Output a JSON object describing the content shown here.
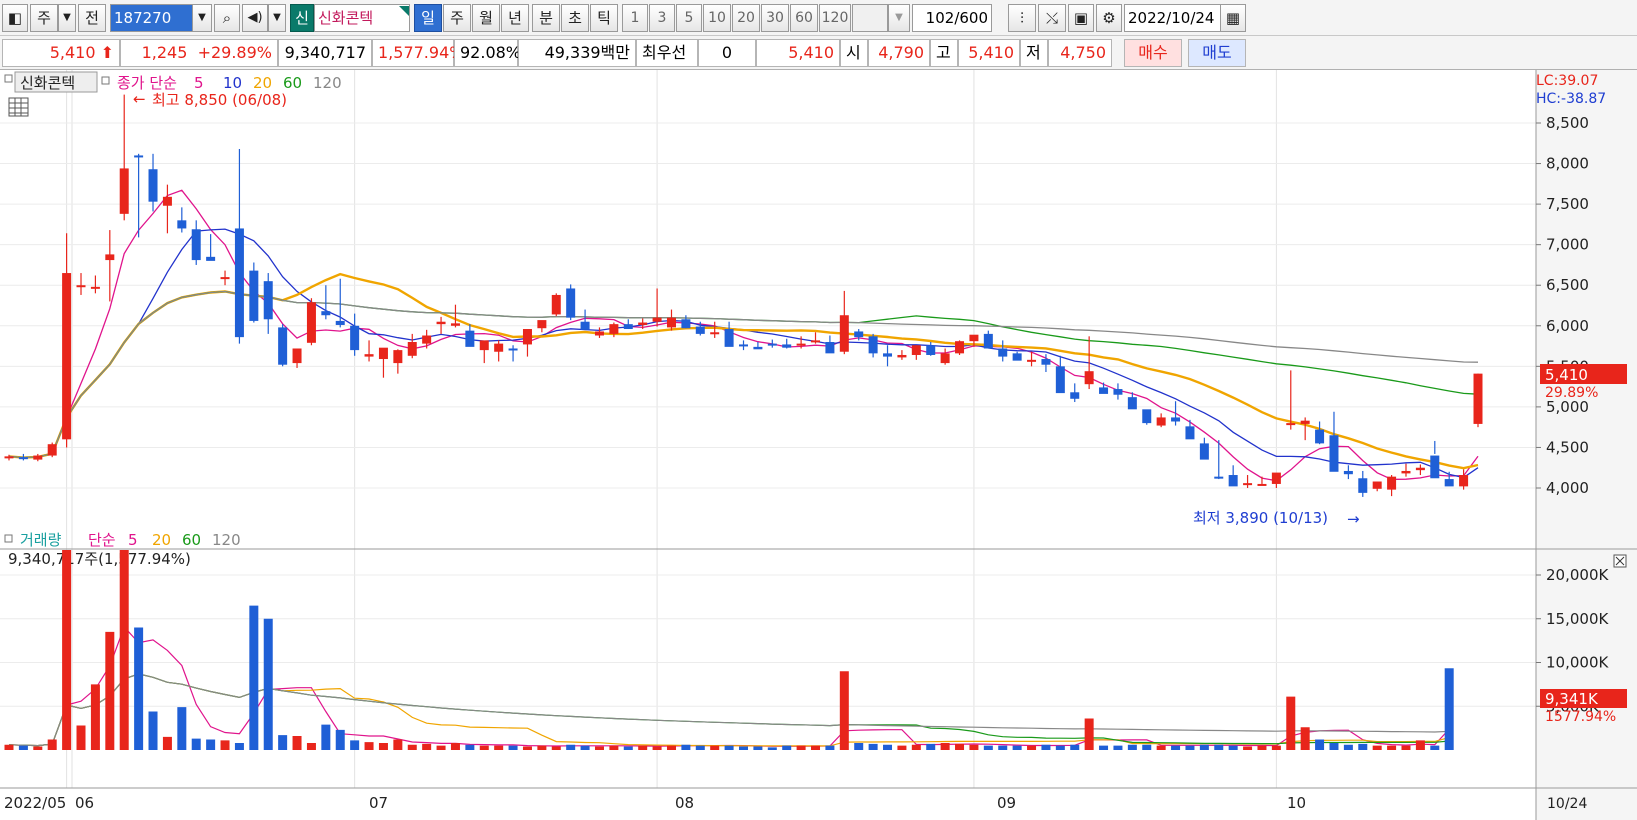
{
  "toolbar": {
    "market_tab": "주",
    "prev_button": "전",
    "code": "187270",
    "credit_badge": "신",
    "stock_name": "신화콘텍",
    "periods": [
      "일",
      "주",
      "월",
      "년",
      "분",
      "초",
      "틱"
    ],
    "active_period": "일",
    "intervals": [
      "1",
      "3",
      "5",
      "10",
      "20",
      "30",
      "60",
      "120"
    ],
    "count": "102",
    "count_total": "/600",
    "date": "2022/10/24"
  },
  "quote": {
    "price": "5,410",
    "change": "1,245",
    "change_pct": "+29.89%",
    "volume": "9,340,717",
    "volume_pct": "1,577.94%",
    "turnover_pct": "92.08%",
    "amount": "49,339백만",
    "best_label": "최우선",
    "best_value": "0",
    "best_price": "5,410",
    "open_label": "시",
    "open": "4,790",
    "high_label": "고",
    "high": "5,410",
    "low_label": "저",
    "low": "4,750",
    "buy_button": "매수",
    "sell_button": "매도"
  },
  "price_panel": {
    "title": "신화콘텍",
    "ma_label": "종가 단순",
    "ma_periods": [
      "5",
      "10",
      "20",
      "60",
      "120"
    ],
    "ma_colors": [
      "#e0148c",
      "#2233cc",
      "#f0a500",
      "#1a9a1a",
      "#888888"
    ],
    "lc": "LC:39.07",
    "hc": "HC:-38.87",
    "high_marker": "최고 8,850 (06/08)",
    "low_marker": "최저 3,890 (10/13)",
    "last_price_tag": "5,410",
    "last_pct_tag": "29.89%",
    "y_ticks": [
      "8,500",
      "8,000",
      "7,500",
      "7,000",
      "6,500",
      "6,000",
      "5,500",
      "5,000",
      "4,500",
      "4,000"
    ]
  },
  "volume_panel": {
    "title": "거래량",
    "ma_label": "단순",
    "ma_periods": [
      "5",
      "20",
      "60",
      "120"
    ],
    "value_text": "9,340,717주(1,577.94%)",
    "last_tag": "9,341K",
    "last_pct_tag": "1577.94%",
    "y_ticks": [
      "20,000K",
      "15,000K",
      "10,000K",
      "5,000K"
    ]
  },
  "x_axis": {
    "labels": [
      "2022/05",
      "06",
      "07",
      "08",
      "09",
      "10"
    ],
    "right_label": "10/24"
  },
  "colors": {
    "up": "#e8251b",
    "down": "#1f5fd6",
    "accent": "#2f6fd1"
  },
  "chart_data": {
    "type": "candlestick",
    "price_axis": [
      3500,
      8900
    ],
    "volume_axis_k": [
      0,
      25000
    ],
    "candles": [
      [
        4370,
        4410,
        4340,
        4390
      ],
      [
        4380,
        4420,
        4340,
        4360
      ],
      [
        4350,
        4420,
        4330,
        4400
      ],
      [
        4400,
        4560,
        4380,
        4540
      ],
      [
        4600,
        7140,
        4500,
        6650
      ],
      [
        6480,
        6650,
        6380,
        6500
      ],
      [
        6460,
        6620,
        6400,
        6480
      ],
      [
        6810,
        7180,
        6300,
        6880
      ],
      [
        7380,
        8850,
        7300,
        7940
      ],
      [
        8100,
        8120,
        7090,
        8090
      ],
      [
        7930,
        8120,
        7410,
        7530
      ],
      [
        7480,
        7740,
        7140,
        7590
      ],
      [
        7300,
        7460,
        7150,
        7200
      ],
      [
        7190,
        7300,
        6750,
        6810
      ],
      [
        6850,
        7130,
        6830,
        6800
      ],
      [
        6580,
        6680,
        6500,
        6600
      ],
      [
        7200,
        8180,
        5780,
        5860
      ],
      [
        6680,
        6780,
        6040,
        6060
      ],
      [
        6550,
        6650,
        5900,
        6080
      ],
      [
        5980,
        6020,
        5500,
        5520
      ],
      [
        5540,
        5720,
        5480,
        5720
      ],
      [
        5790,
        6340,
        5760,
        6290
      ],
      [
        6180,
        6500,
        6080,
        6130
      ],
      [
        6060,
        6580,
        5980,
        6010
      ],
      [
        6000,
        6150,
        5630,
        5700
      ],
      [
        5620,
        5820,
        5560,
        5650
      ],
      [
        5590,
        5690,
        5360,
        5730
      ],
      [
        5540,
        5710,
        5410,
        5700
      ],
      [
        5630,
        5900,
        5600,
        5800
      ],
      [
        5780,
        5950,
        5720,
        5880
      ],
      [
        6020,
        6110,
        5900,
        6050
      ],
      [
        6000,
        6260,
        5980,
        6030
      ],
      [
        5940,
        6020,
        5790,
        5740
      ],
      [
        5700,
        5800,
        5540,
        5820
      ],
      [
        5680,
        5820,
        5560,
        5780
      ],
      [
        5720,
        5760,
        5560,
        5700
      ],
      [
        5770,
        5880,
        5620,
        5960
      ],
      [
        5970,
        6040,
        5920,
        6070
      ],
      [
        6140,
        6400,
        6120,
        6380
      ],
      [
        6460,
        6510,
        6070,
        6100
      ],
      [
        6050,
        6200,
        5980,
        5950
      ],
      [
        5880,
        5980,
        5850,
        5930
      ],
      [
        5900,
        6040,
        5860,
        6020
      ],
      [
        6020,
        6080,
        5960,
        5960
      ],
      [
        6010,
        6090,
        5960,
        6040
      ],
      [
        6050,
        6460,
        5990,
        6100
      ],
      [
        5980,
        6200,
        5940,
        6100
      ],
      [
        6080,
        6130,
        5970,
        5970
      ],
      [
        5990,
        6050,
        5880,
        5900
      ],
      [
        5910,
        6050,
        5850,
        5920
      ],
      [
        5960,
        6050,
        5840,
        5740
      ],
      [
        5770,
        5820,
        5700,
        5750
      ],
      [
        5740,
        5800,
        5720,
        5710
      ],
      [
        5780,
        5830,
        5730,
        5760
      ],
      [
        5770,
        5840,
        5720,
        5730
      ],
      [
        5760,
        5870,
        5720,
        5780
      ],
      [
        5800,
        5920,
        5780,
        5820
      ],
      [
        5800,
        5880,
        5750,
        5660
      ],
      [
        5680,
        6430,
        5650,
        6130
      ],
      [
        5930,
        5960,
        5820,
        5860
      ],
      [
        5870,
        5900,
        5610,
        5660
      ],
      [
        5660,
        5760,
        5500,
        5620
      ],
      [
        5610,
        5700,
        5580,
        5640
      ],
      [
        5640,
        5760,
        5580,
        5760
      ],
      [
        5760,
        5800,
        5630,
        5640
      ],
      [
        5540,
        5720,
        5520,
        5660
      ],
      [
        5660,
        5820,
        5640,
        5810
      ],
      [
        5810,
        5860,
        5740,
        5890
      ],
      [
        5900,
        5940,
        5770,
        5720
      ],
      [
        5720,
        5820,
        5560,
        5620
      ],
      [
        5660,
        5680,
        5580,
        5570
      ],
      [
        5560,
        5680,
        5500,
        5580
      ],
      [
        5590,
        5650,
        5430,
        5520
      ],
      [
        5500,
        5630,
        5280,
        5170
      ],
      [
        5180,
        5290,
        5060,
        5100
      ],
      [
        5280,
        5870,
        5220,
        5440
      ],
      [
        5240,
        5300,
        5170,
        5160
      ],
      [
        5220,
        5290,
        5090,
        5150
      ],
      [
        5120,
        5180,
        4990,
        4970
      ],
      [
        4970,
        4960,
        4780,
        4800
      ],
      [
        4770,
        4920,
        4750,
        4870
      ],
      [
        4870,
        5070,
        4770,
        4820
      ],
      [
        4760,
        4840,
        4700,
        4600
      ],
      [
        4550,
        4620,
        4460,
        4350
      ],
      [
        4140,
        4590,
        4110,
        4130
      ],
      [
        4160,
        4280,
        4120,
        4020
      ],
      [
        4050,
        4160,
        4000,
        4060
      ],
      [
        4050,
        4140,
        4050,
        4050
      ],
      [
        4050,
        4170,
        4000,
        4190
      ],
      [
        4780,
        5450,
        4720,
        4800
      ],
      [
        4790,
        4870,
        4590,
        4830
      ],
      [
        4720,
        4820,
        4540,
        4550
      ],
      [
        4650,
        4940,
        4630,
        4200
      ],
      [
        4210,
        4280,
        4110,
        4170
      ],
      [
        4120,
        4210,
        3890,
        3940
      ],
      [
        3990,
        4080,
        3960,
        4080
      ],
      [
        3980,
        4160,
        3900,
        4140
      ],
      [
        4180,
        4300,
        4140,
        4210
      ],
      [
        4220,
        4290,
        4160,
        4250
      ],
      [
        4400,
        4580,
        4420,
        4120
      ],
      [
        4110,
        4200,
        4050,
        4020
      ],
      [
        4020,
        4230,
        3980,
        4160
      ],
      [
        4790,
        5410,
        4750,
        5410
      ]
    ],
    "volume_k": [
      600,
      500,
      400,
      1200,
      23000,
      2800,
      7500,
      13500,
      23500,
      14000,
      4400,
      1500,
      4900,
      1300,
      1200,
      1100,
      800,
      16500,
      15000,
      1700,
      1600,
      800,
      2900,
      2300,
      1100,
      900,
      800,
      1200,
      600,
      700,
      500,
      800,
      600,
      500,
      500,
      500,
      400,
      500,
      400,
      600,
      500,
      400,
      500,
      400,
      500,
      400,
      500,
      600,
      500,
      500,
      500,
      400,
      400,
      300,
      500,
      500,
      500,
      500,
      9000,
      800,
      700,
      600,
      500,
      600,
      700,
      800,
      700,
      600,
      500,
      500,
      500,
      500,
      600,
      500,
      600,
      3600,
      500,
      500,
      600,
      600,
      500,
      500,
      500,
      600,
      600,
      500,
      400,
      500,
      500,
      6100,
      2600,
      1200,
      800,
      600,
      700,
      500,
      500,
      500,
      1100,
      500,
      9341
    ],
    "series": [
      {
        "name": "5",
        "color": "#e0148c"
      },
      {
        "name": "10",
        "color": "#2233cc"
      },
      {
        "name": "20",
        "color": "#f0a500"
      },
      {
        "name": "60",
        "color": "#1a9a1a"
      },
      {
        "name": "120",
        "color": "#888888"
      }
    ],
    "x_categories": [
      "2022/05",
      "06",
      "07",
      "08",
      "09",
      "10"
    ],
    "last_date": "10/24"
  }
}
